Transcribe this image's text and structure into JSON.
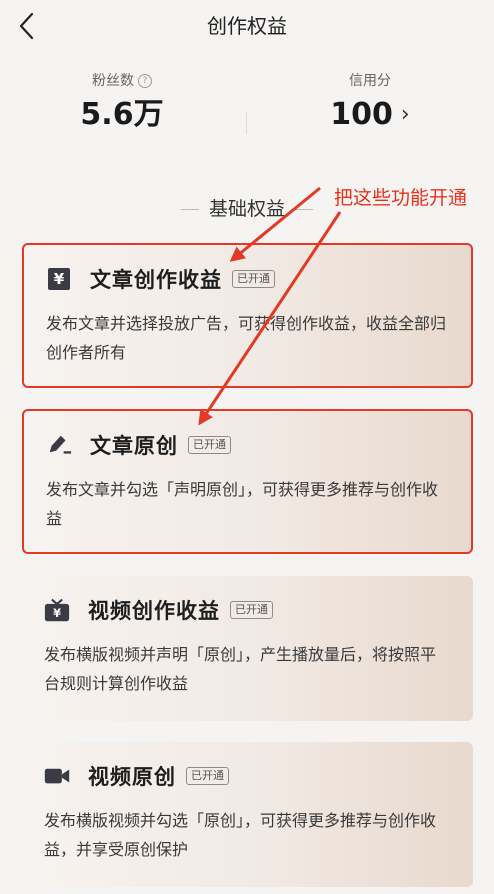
{
  "header": {
    "title": "创作权益",
    "back_icon": "chevron-left-icon"
  },
  "stats": {
    "fans": {
      "label": "粉丝数",
      "value": "5.6万",
      "icon": "help-icon"
    },
    "credit": {
      "label": "信用分",
      "value": "100",
      "icon": "chevron-right-icon"
    }
  },
  "section": {
    "title": "基础权益"
  },
  "annotation": {
    "text": "把这些功能开通",
    "color": "#e23a26"
  },
  "cards": [
    {
      "icon": "yen-icon",
      "title": "文章创作收益",
      "badge": "已开通",
      "desc": "发布文章并选择投放广告，可获得创作收益，收益全部归创作者所有",
      "highlighted": true
    },
    {
      "icon": "pen-icon",
      "title": "文章原创",
      "badge": "已开通",
      "desc": "发布文章并勾选「声明原创」，可获得更多推荐与创作收益",
      "highlighted": true
    },
    {
      "icon": "tv-yen-icon",
      "title": "视频创作收益",
      "badge": "已开通",
      "desc": "发布横版视频并声明「原创」，产生播放量后，将按照平台规则计算创作收益",
      "highlighted": false
    },
    {
      "icon": "video-camera-icon",
      "title": "视频原创",
      "badge": "已开通",
      "desc": "发布横版视频并勾选「原创」，可获得更多推荐与创作收益，并享受原创保护",
      "highlighted": false
    }
  ]
}
